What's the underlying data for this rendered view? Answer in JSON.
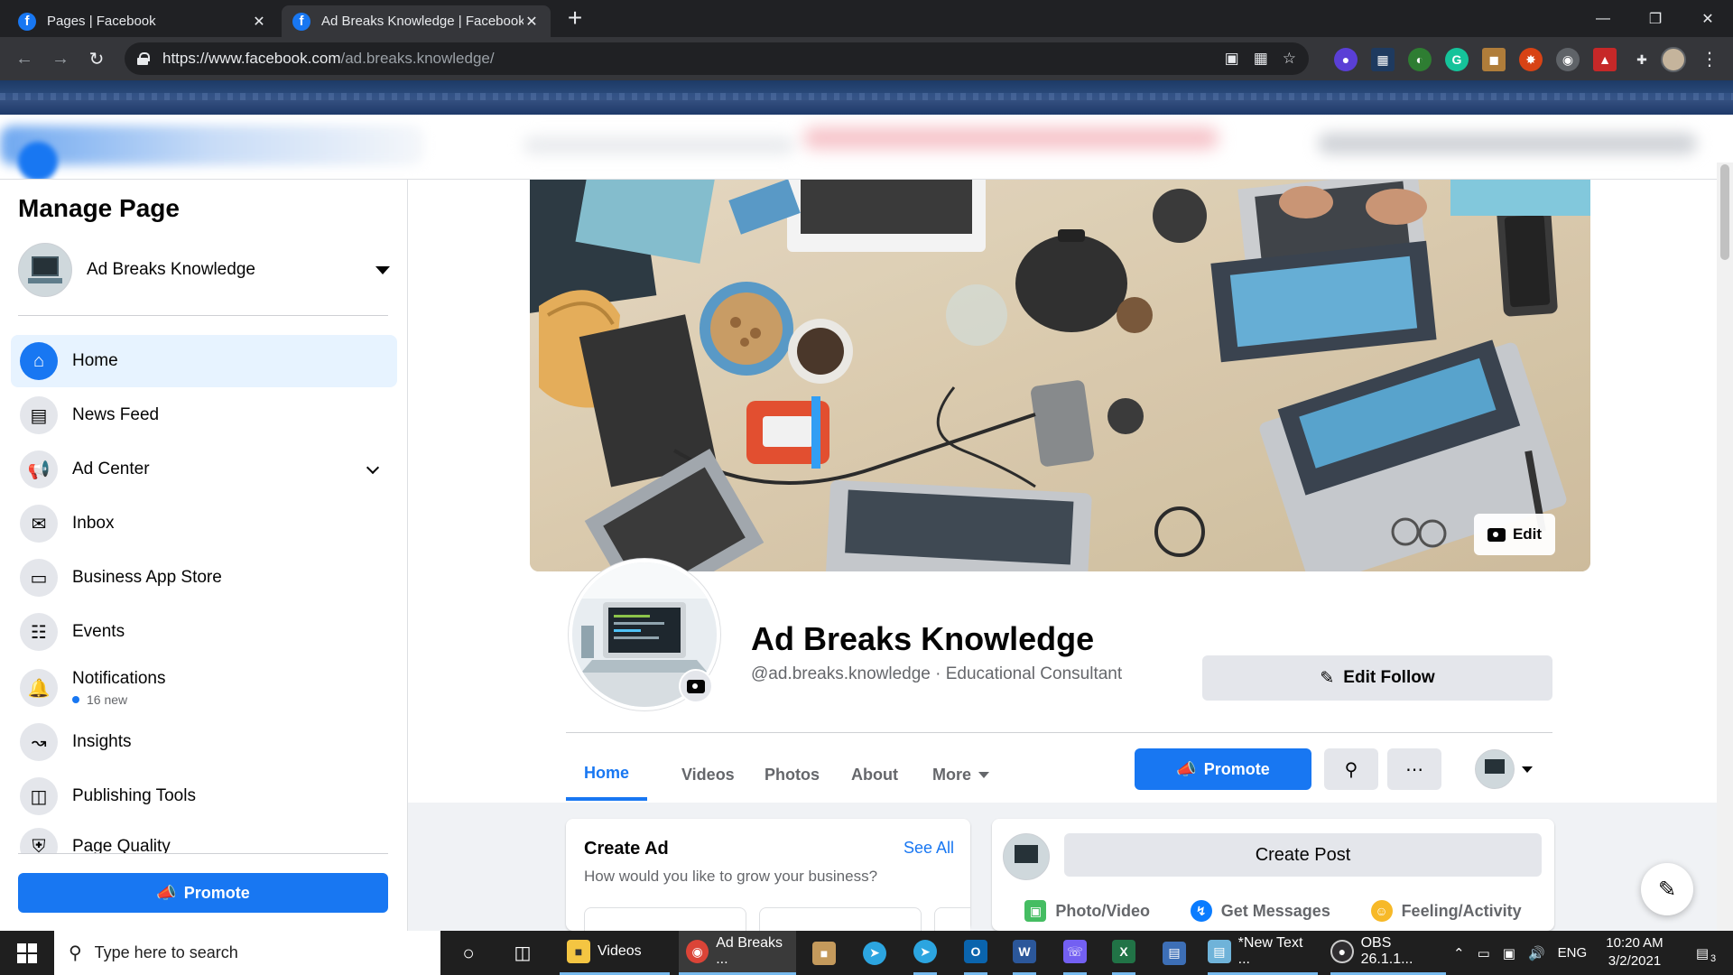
{
  "browser": {
    "tabs": [
      {
        "label": "Pages | Facebook",
        "active": false
      },
      {
        "label": "Ad Breaks Knowledge | Facebook",
        "active": true
      }
    ],
    "url_main": "https://www.facebook.com",
    "url_path": "/ad.breaks.knowledge/"
  },
  "sidebar": {
    "title": "Manage Page",
    "page_name": "Ad Breaks Knowledge",
    "items": [
      {
        "label": "Home",
        "icon": "home-icon",
        "active": true
      },
      {
        "label": "News Feed",
        "icon": "news-feed-icon"
      },
      {
        "label": "Ad Center",
        "icon": "megaphone-icon"
      },
      {
        "label": "Inbox",
        "icon": "inbox-icon"
      },
      {
        "label": "Business App Store",
        "icon": "cube-icon"
      },
      {
        "label": "Events",
        "icon": "calendar-icon"
      },
      {
        "label": "Notifications",
        "icon": "bell-icon",
        "sub": "16 new"
      },
      {
        "label": "Insights",
        "icon": "insights-icon"
      },
      {
        "label": "Publishing Tools",
        "icon": "publishing-tools-icon"
      },
      {
        "label": "Page Quality",
        "icon": "shield-icon"
      }
    ],
    "promote_label": "Promote"
  },
  "profile": {
    "cover_edit_label": "Edit",
    "name": "Ad Breaks Knowledge",
    "handle": "@ad.breaks.knowledge · Educational Consultant",
    "edit_follow_label": "Edit Follow",
    "tabs": [
      "Home",
      "Videos",
      "Photos",
      "About",
      "More"
    ],
    "promote_label": "Promote"
  },
  "create_ad": {
    "title": "Create Ad",
    "subtitle": "How would you like to grow your business?",
    "see_all": "See All"
  },
  "create_post": {
    "button_label": "Create Post",
    "actions": [
      "Photo/Video",
      "Get Messages",
      "Feeling/Activity"
    ]
  },
  "taskbar": {
    "search_placeholder": "Type here to search",
    "apps": [
      {
        "label": "Videos"
      },
      {
        "label": "Ad Breaks ..."
      },
      {
        "label": "*New Text ..."
      },
      {
        "label": "OBS 26.1.1..."
      }
    ],
    "language": "ENG",
    "time": "10:20 AM",
    "date": "3/2/2021",
    "notification_count": "3"
  },
  "colors": {
    "facebook_blue": "#1877f2",
    "browser_dark": "#202124",
    "taskbar": "#1f1f1f"
  }
}
